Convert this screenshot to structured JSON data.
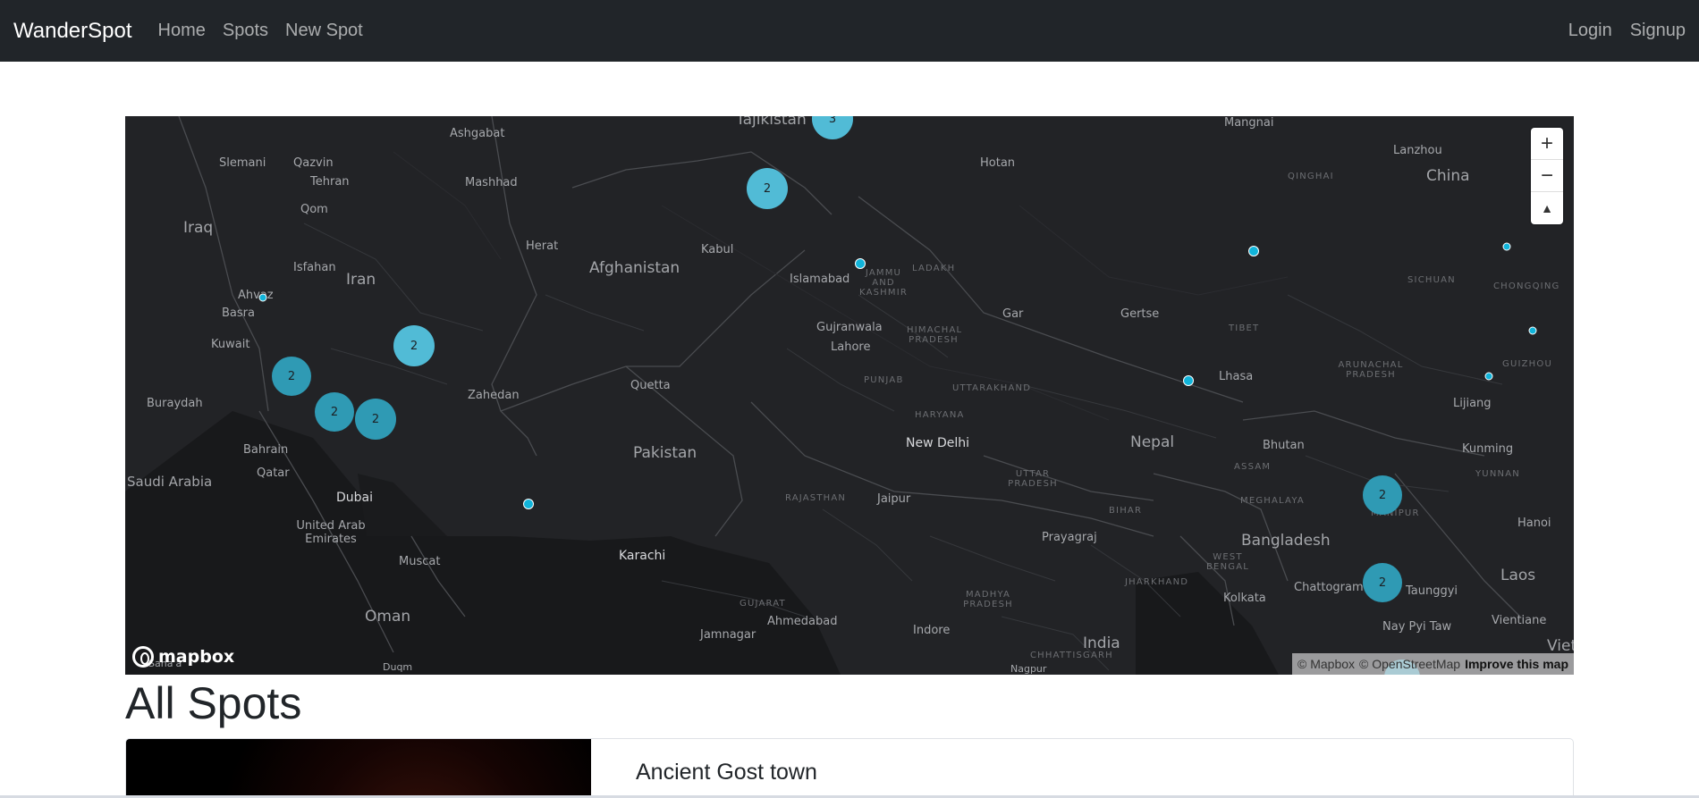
{
  "navbar": {
    "brand": "WanderSpot",
    "links": [
      "Home",
      "Spots",
      "New Spot"
    ],
    "right_links": [
      "Login",
      "Signup"
    ],
    "background": "#212529"
  },
  "map": {
    "zoom_in_label": "+",
    "zoom_out_label": "−",
    "compass_label": "▲",
    "logo_text": "mapbox",
    "attribution": {
      "mapbox": "© Mapbox",
      "osm": "© OpenStreetMap",
      "improve": "Improve this map"
    },
    "cluster_color": "#51bbd6",
    "point_color": "#11b4da",
    "labels": {
      "tajikistan": "Tajikistan",
      "ashgabat": "Ashgabat",
      "mangnai": "Mangnai",
      "lanzhou": "Lanzhou",
      "china": "China",
      "qinghai": "QINGHAI",
      "hotan": "Hotan",
      "slemani": "Slemani",
      "qazvin": "Qazvin",
      "tehran": "Tehran",
      "mashhad": "Mashhad",
      "qom": "Qom",
      "iraq": "Iraq",
      "herat": "Herat",
      "afghanistan": "Afghanistan",
      "kabul": "Kabul",
      "islamabad": "Islamabad",
      "jammu_kashmir": "JAMMU AND KASHMIR",
      "ladakh": "LADAKH",
      "isfahan": "Isfahan",
      "iran": "Iran",
      "ahvaz": "Ahvaz",
      "basra": "Basra",
      "kuwait": "Kuwait",
      "gujranwala": "Gujranwala",
      "lahore": "Lahore",
      "himachal": "HIMACHAL PRADESH",
      "gar": "Gar",
      "gertse": "Gertse",
      "tibet": "TIBET",
      "sichuan": "SICHUAN",
      "chongqing": "CHONGQING",
      "guizhou": "GUIZHOU",
      "quetta": "Quetta",
      "punjab": "PUNJAB",
      "uttarakhand": "UTTARAKHAND",
      "lhasa": "Lhasa",
      "arunachal": "ARUNACHAL PRADESH",
      "lijiang": "Lijiang",
      "buraydah": "Buraydah",
      "zahedan": "Zahedan",
      "haryana": "HARYANA",
      "new_delhi": "New Delhi",
      "nepal": "Nepal",
      "bhutan": "Bhutan",
      "kunming": "Kunming",
      "bahrain": "Bahrain",
      "pakistan": "Pakistan",
      "saudi_arabia": "Saudi Arabia",
      "qatar": "Qatar",
      "uttar_pradesh": "UTTAR PRADESH",
      "assam": "ASSAM",
      "yunnan": "YUNNAN",
      "dubai": "Dubai",
      "rajasthan": "RAJASTHAN",
      "jaipur": "Jaipur",
      "bihar": "BIHAR",
      "meghalaya": "MEGHALAYA",
      "manipur": "MANIPUR",
      "uae": "United Arab Emirates",
      "hanoi": "Hanoi",
      "prayagraj": "Prayagraj",
      "bangladesh": "Bangladesh",
      "muscat": "Muscat",
      "karachi": "Karachi",
      "west_bengal": "WEST BENGAL",
      "jharkhand": "JHARKHAND",
      "chattogram": "Chattogram",
      "taunggyi": "Taunggyi",
      "laos": "Laos",
      "kolkata": "Kolkata",
      "gujarat": "GUJARAT",
      "madhya_pradesh": "MADHYA PRADESH",
      "oman": "Oman",
      "ahmedabad": "Ahmedabad",
      "vientiane": "Vientiane",
      "nay_pyi_taw": "Nay Pyi Taw",
      "indore": "Indore",
      "jamnagar": "Jamnagar",
      "india": "India",
      "chhattisgarh": "CHHATTISGARH",
      "duqm": "Duqm",
      "sana": "Sana'a",
      "nagpur": "Nagpur",
      "viet": "Viet"
    },
    "clusters": {
      "tajik_count": "3",
      "kabul_count": "2",
      "iran_count": "2",
      "gulf_count": "2",
      "bandar_count": "2",
      "kerman_count": "2",
      "manipur_count": "2",
      "myanmar_count": "2"
    }
  },
  "main": {
    "heading": "All Spots",
    "spots": [
      {
        "title": "Ancient Gost town"
      }
    ]
  }
}
